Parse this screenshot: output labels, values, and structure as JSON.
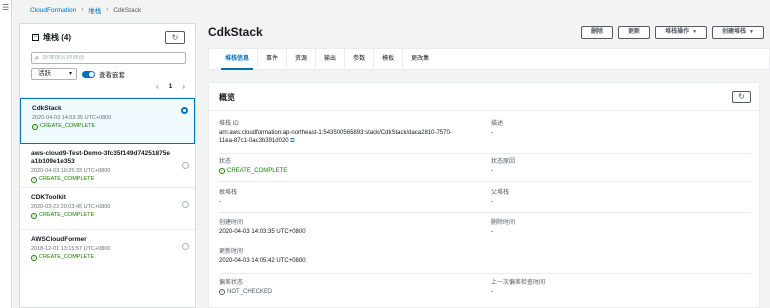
{
  "breadcrumb": {
    "service": "CloudFormation",
    "section": "堆栈",
    "current": "CdkStack"
  },
  "stacks_panel": {
    "title": "堆栈 (4)",
    "search_placeholder": "按堆栈名称筛选",
    "filter_value": "活跃",
    "toggle_label": "查看嵌套",
    "page": "1"
  },
  "stacks": [
    {
      "name": "CdkStack",
      "date": "2020-04-03 14:03:35 UTC+0800",
      "status": "CREATE_COMPLETE",
      "selected": true
    },
    {
      "name": "aws-cloud9-Test-Demo-3fc35f149d74251875ea1b109e1e353",
      "name_line1": "aws-cloud9-Test-Demo-3fc35f149d74251875e",
      "name_line2": "a1b109e1e353",
      "date": "2020-04-03 10:25:33 UTC+0800",
      "status": "CREATE_COMPLETE",
      "selected": false
    },
    {
      "name": "CDKToolkit",
      "date": "2020-03-23 20:03:45 UTC+0800",
      "status": "CREATE_COMPLETE",
      "selected": false
    },
    {
      "name": "AWSCloudFormer",
      "date": "2018-12-01 13:15:57 UTC+0800",
      "status": "CREATE_COMPLETE",
      "selected": false
    }
  ],
  "page_title": "CdkStack",
  "actions": {
    "delete": "删除",
    "update": "更新",
    "stack_actions": "堆栈操作",
    "create_stack": "创建堆栈"
  },
  "tabs": [
    "堆栈信息",
    "事件",
    "资源",
    "输出",
    "参数",
    "模板",
    "更改集"
  ],
  "overview": {
    "title": "概览",
    "stack_id_label": "堆栈 ID",
    "stack_id_line1": "arn:aws:cloudformation:ap-northeast-1:543500565893:stack/CdkStack/daca2810-7570-",
    "stack_id_line2": "11ea-87c1-0ac3b391d020",
    "description_label": "描述",
    "description_value": "-",
    "status_label": "状态",
    "status_value": "CREATE_COMPLETE",
    "status_reason_label": "状态原因",
    "status_reason_value": "-",
    "root_stack_label": "根堆栈",
    "root_stack_value": "-",
    "parent_stack_label": "父堆栈",
    "parent_stack_value": "-",
    "created_label": "创建时间",
    "created_value": "2020-04-03 14:03:35 UTC+0800",
    "deleted_label": "删除时间",
    "deleted_value": "-",
    "updated_label": "更新时间",
    "updated_value": "2020-04-03 14:05:42 UTC+0800",
    "drift_label": "偏差状态",
    "drift_value": "NOT_CHECKED",
    "last_drift_label": "上一次偏差检查时间",
    "last_drift_value": "-"
  },
  "colors": {
    "link": "#0073bb",
    "success": "#1d8102",
    "border": "#eaeded"
  },
  "icons": {
    "refresh": "refresh-icon",
    "search": "search-icon",
    "external": "external-link-icon",
    "success": "success-icon"
  }
}
